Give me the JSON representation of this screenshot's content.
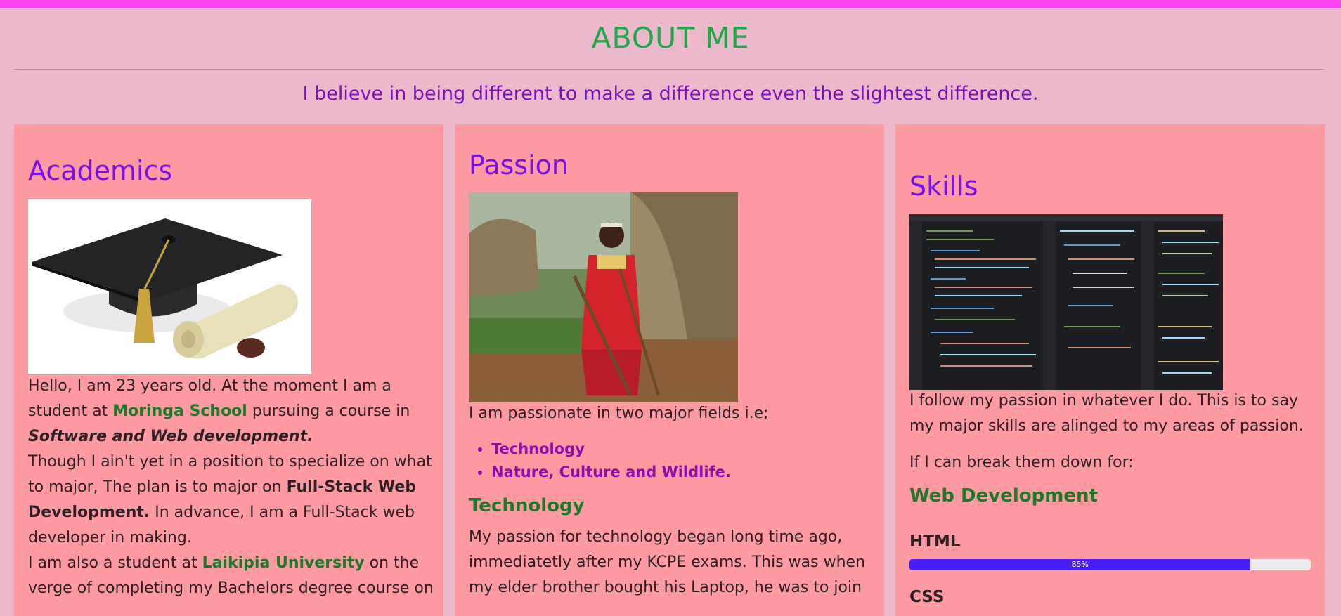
{
  "header": {
    "title": "ABOUT ME",
    "tagline": "I believe in being different to make a difference even the slightest difference."
  },
  "academics": {
    "heading": "Academics",
    "image_subject": "graduation cap and diploma scroll",
    "p1_a": "Hello, I am 23 years old. At the moment I am a student at ",
    "school": "Moringa School",
    "p1_b": " pursuing a course in",
    "course": "Software and Web development.",
    "p2_a": "Though I ain't yet in a position to specialize on what to major, The plan is to major on ",
    "major": "Full-Stack Web Development.",
    "p2_b": " In advance, I am a Full-Stack web developer in making.",
    "p3_a": "I am also a student at ",
    "university": "Laikipia University",
    "p3_b": " on the verge of completing my Bachelors degree course on"
  },
  "passion": {
    "heading": "Passion",
    "image_subject": "man in red Maasai attire standing by a thatched hut",
    "intro": "I am passionate in two major fields i.e;",
    "fields": [
      "Technology",
      "Nature, Culture and Wildlife."
    ],
    "sub_heading": "Technology",
    "text": "My passion for technology began long time ago, immediatetly after my KCPE exams. This was when my elder brother bought his Laptop, he was to join"
  },
  "skills": {
    "heading": "Skills",
    "image_subject": "code editor screenshot",
    "p1": "I follow my passion in whatever I do. This is to say my major skills are alinged to my areas of passion.",
    "p2": "If I can break them down for:",
    "sub_heading": "Web Development",
    "items": [
      {
        "name": "HTML",
        "percent": 85,
        "percent_label": "85%"
      },
      {
        "name": "CSS"
      }
    ]
  },
  "colors": {
    "topbar": "#fc45f4",
    "page_bg": "#ebb9cb",
    "card_bg": "#fe9aa2",
    "title": "#1ea848",
    "tagline": "#7a10c2",
    "heading": "#7a10f0",
    "accent_green": "#1a7a28",
    "list_purple": "#8a0fb0",
    "bar_fill": "#4a1ff7"
  }
}
